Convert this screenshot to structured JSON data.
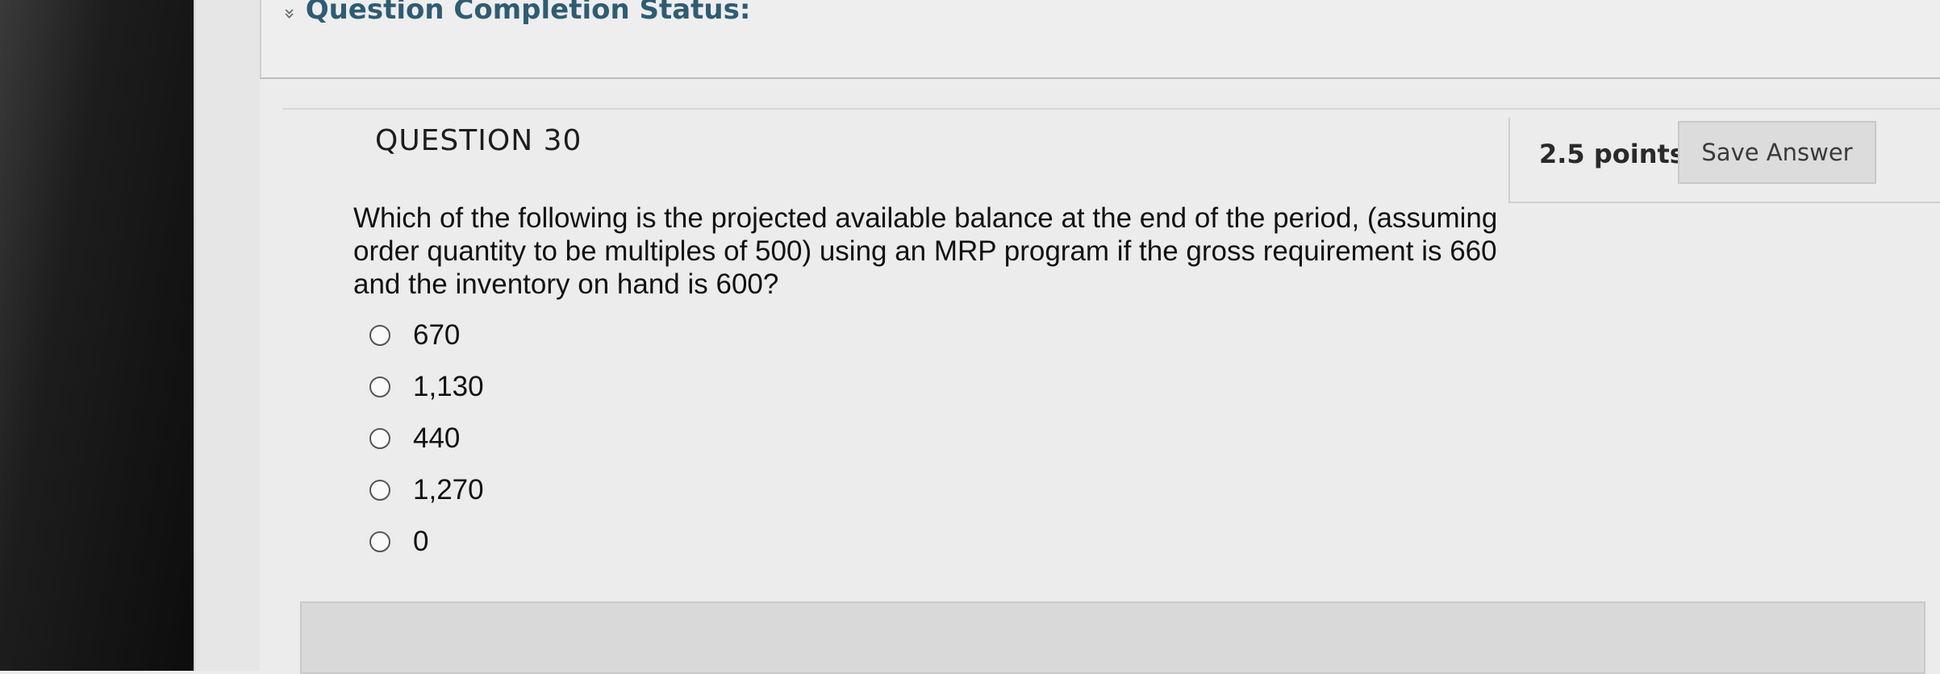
{
  "status": {
    "chevron": "»",
    "title": "Question Completion Status:"
  },
  "question": {
    "number_label": "QUESTION 30",
    "points": "2.5 points",
    "save_label": "Save Answer",
    "text": "Which of the following is the projected available balance at the end of the period, (assuming order quantity to be multiples of 500) using an MRP program if the gross requirement is 660 and the inventory on hand is 600?",
    "options": [
      {
        "label": "670"
      },
      {
        "label": "1,130"
      },
      {
        "label": "440"
      },
      {
        "label": "1,270"
      },
      {
        "label": "0"
      }
    ]
  }
}
